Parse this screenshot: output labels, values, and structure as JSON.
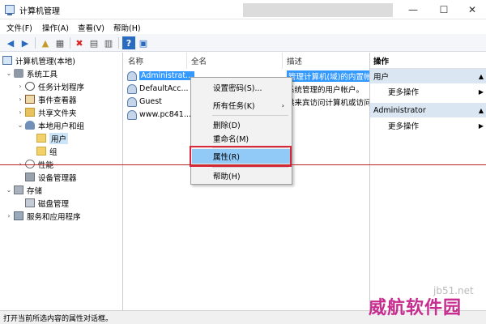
{
  "window": {
    "title": "计算机管理",
    "minimize": "—",
    "maximize": "☐",
    "close": "✕"
  },
  "menu": [
    "文件(F)",
    "操作(A)",
    "查看(V)",
    "帮助(H)"
  ],
  "toolbar": {
    "back": "◀",
    "forward": "▶",
    "up": "▲",
    "show": "▦",
    "delete": "✖",
    "properties": "▤",
    "export": "▥",
    "help": "?",
    "view": "▣"
  },
  "tree": {
    "root": "计算机管理(本地)",
    "system_tools": "系统工具",
    "task_scheduler": "任务计划程序",
    "event_viewer": "事件查看器",
    "shared_folders": "共享文件夹",
    "local_users": "本地用户和组",
    "users": "用户",
    "groups": "组",
    "performance": "性能",
    "device_manager": "设备管理器",
    "storage": "存储",
    "disk_management": "磁盘管理",
    "services": "服务和应用程序"
  },
  "list": {
    "columns": [
      "名称",
      "全名",
      "描述"
    ],
    "rows": [
      {
        "name": "Administrat...",
        "fullname": "",
        "desc": "管理计算机(域)的内置帐"
      },
      {
        "name": "DefaultAcc...",
        "fullname": "",
        "desc": "系统管理的用户帐户。"
      },
      {
        "name": "Guest",
        "fullname": "",
        "desc": "供来宾访问计算机或访问"
      },
      {
        "name": "www.pc841...",
        "fullname": "",
        "desc": ""
      }
    ]
  },
  "context_menu": {
    "set_password": "设置密码(S)...",
    "all_tasks": "所有任务(K)",
    "delete": "删除(D)",
    "rename": "重命名(M)",
    "properties": "属性(R)",
    "help": "帮助(H)"
  },
  "actions": {
    "title": "操作",
    "section1": "用户",
    "more1": "更多操作",
    "section2": "Administrator",
    "more2": "更多操作"
  },
  "status": "打开当前所选内容的属性对话框。",
  "watermark": {
    "site": "jb51.net",
    "brand": "威航软件园"
  },
  "colors": {
    "selection": "#3399ff",
    "highlight_box": "#d9283a",
    "section_bg": "#dbe6f3"
  }
}
